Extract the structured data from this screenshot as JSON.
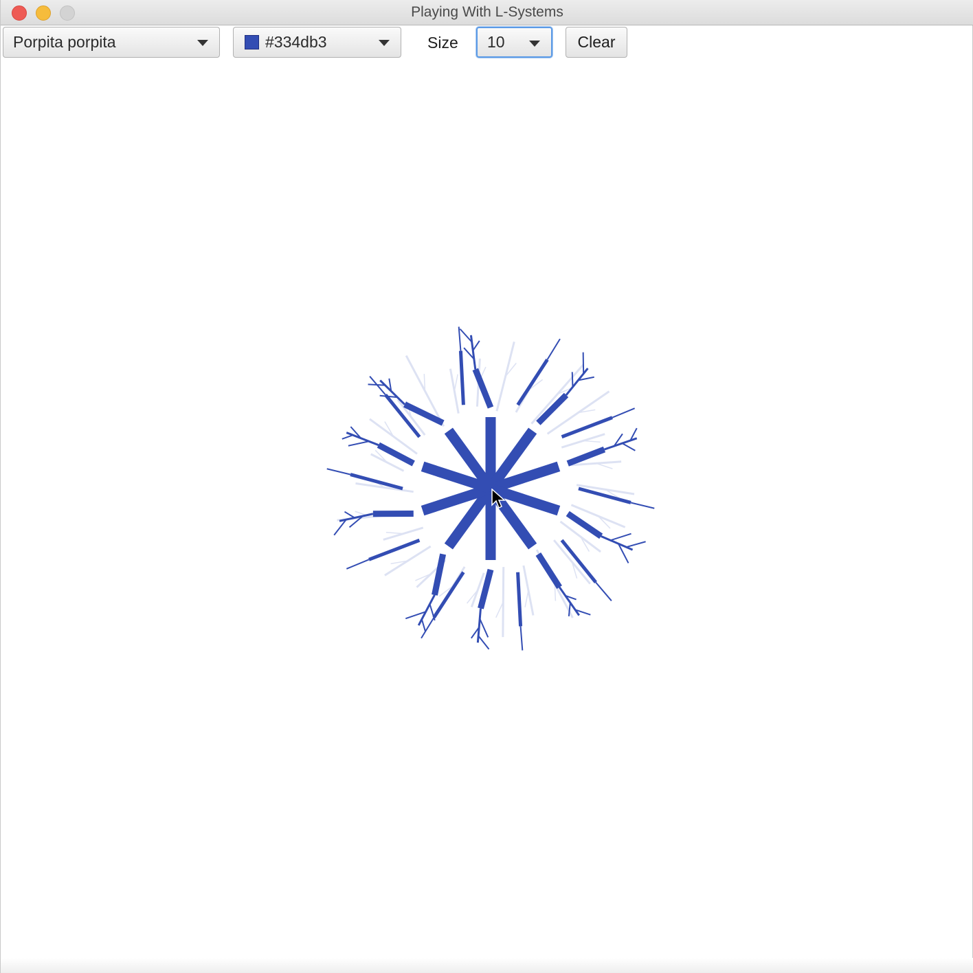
{
  "window": {
    "title": "Playing With L-Systems"
  },
  "toolbar": {
    "species_select": {
      "value": "Porpita porpita"
    },
    "color_picker": {
      "value": "#334db3",
      "swatch_color": "#334db3"
    },
    "size_label": "Size",
    "size_select": {
      "value": "10"
    },
    "clear_label": "Clear"
  },
  "canvas": {
    "stroke_color": "#334db3",
    "faint_color": "#dde2f3",
    "central_arms": 10,
    "background": "#ffffff"
  },
  "icons": {
    "dropdown": "chevron-down-icon",
    "cursor": "mouse-pointer-icon"
  }
}
